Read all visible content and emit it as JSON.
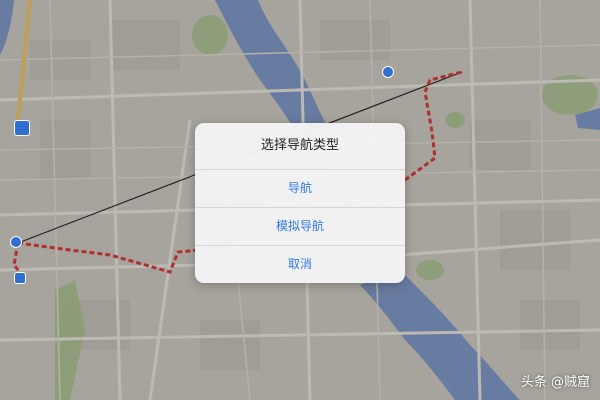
{
  "dialog": {
    "title": "选择导航类型",
    "buttons": [
      {
        "label": "导航"
      },
      {
        "label": "模拟导航"
      },
      {
        "label": "取消"
      }
    ]
  },
  "watermark": "头条 @贼窟",
  "colors": {
    "map_land": "#c9c6bd",
    "water": "#7f97c4",
    "park": "#a9bf8d",
    "route": "#d93a3a",
    "accent": "#2f7ae5"
  },
  "icons": {
    "start_marker": "map-pin-icon",
    "end_marker": "destination-pin-icon",
    "poi": "poi-icon"
  }
}
